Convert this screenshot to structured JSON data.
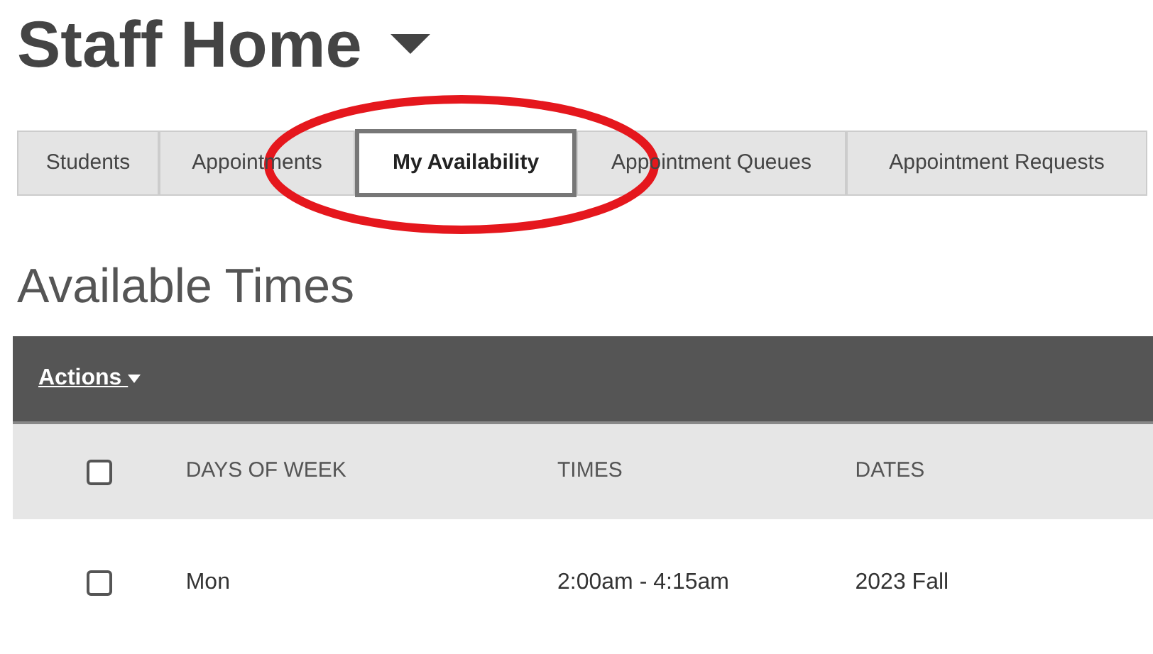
{
  "page_title": "Staff Home",
  "tabs": [
    {
      "label": "Students",
      "selected": false
    },
    {
      "label": "Appointments",
      "selected": false
    },
    {
      "label": "My Availability",
      "selected": true
    },
    {
      "label": "Appointment Queues",
      "selected": false
    },
    {
      "label": "Appointment Requests",
      "selected": false
    }
  ],
  "annotation": {
    "kind": "ellipse"
  },
  "section_title": "Available Times",
  "table": {
    "actions": "Actions",
    "columns": [
      "DAYS OF WEEK",
      "TIMES",
      "DATES"
    ],
    "header_checked": false,
    "rows": [
      {
        "checked": false,
        "cells": [
          "Mon",
          "2:00am - 4:15am",
          "2023 Fall"
        ]
      }
    ]
  }
}
